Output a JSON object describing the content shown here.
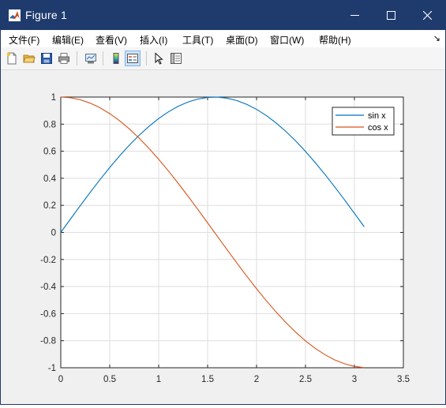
{
  "window": {
    "title": "Figure 1",
    "titlebar_color": "#1f3b6e"
  },
  "menu": {
    "items": [
      "文件(F)",
      "编辑(E)",
      "查看(V)",
      "插入(I)",
      "工具(T)",
      "桌面(D)",
      "窗口(W)",
      "帮助(H)"
    ]
  },
  "toolbar": {
    "icons": [
      "new-figure-icon",
      "open-file-icon",
      "save-figure-icon",
      "print-figure-icon",
      "link-plot-icon",
      "colorbar-icon",
      "legend-icon",
      "edit-plot-icon",
      "property-inspector-icon"
    ]
  },
  "chart_data": {
    "type": "line",
    "x": [
      0,
      0.1,
      0.2,
      0.3,
      0.4,
      0.5,
      0.6,
      0.7,
      0.8,
      0.9,
      1.0,
      1.1,
      1.2,
      1.3,
      1.4,
      1.5,
      1.6,
      1.7,
      1.8,
      1.9,
      2.0,
      2.1,
      2.2,
      2.3,
      2.4,
      2.5,
      2.6,
      2.7,
      2.8,
      2.9,
      3.0,
      3.1
    ],
    "series": [
      {
        "name": "sin x",
        "color": "#0072BD",
        "values": [
          0,
          0.0998,
          0.1987,
          0.2955,
          0.3894,
          0.4794,
          0.5646,
          0.6442,
          0.7174,
          0.7833,
          0.8415,
          0.8912,
          0.932,
          0.9636,
          0.9854,
          0.9975,
          0.9996,
          0.9917,
          0.9738,
          0.9463,
          0.9093,
          0.8632,
          0.8085,
          0.7457,
          0.6755,
          0.5985,
          0.5155,
          0.4274,
          0.335,
          0.2392,
          0.1411,
          0.0416
        ]
      },
      {
        "name": "cos x",
        "color": "#D95319",
        "values": [
          1,
          0.995,
          0.9801,
          0.9553,
          0.9211,
          0.8776,
          0.8253,
          0.7648,
          0.6967,
          0.6216,
          0.5403,
          0.4536,
          0.3624,
          0.2675,
          0.17,
          0.0707,
          -0.0292,
          -0.1288,
          -0.2272,
          -0.3233,
          -0.4161,
          -0.5048,
          -0.5885,
          -0.6663,
          -0.7374,
          -0.8011,
          -0.8569,
          -0.9041,
          -0.9422,
          -0.971,
          -0.99,
          -0.9991
        ]
      }
    ],
    "xlim": [
      0,
      3.5
    ],
    "ylim": [
      -1,
      1
    ],
    "xticks": [
      "0",
      "0.5",
      "1",
      "1.5",
      "2",
      "2.5",
      "3",
      "3.5"
    ],
    "yticks": [
      "1",
      "0.8",
      "0.6",
      "0.4",
      "0.2",
      "0",
      "-0.2",
      "-0.4",
      "-0.6",
      "-0.8",
      "-1"
    ],
    "grid": true,
    "legend_position": "top-right"
  }
}
